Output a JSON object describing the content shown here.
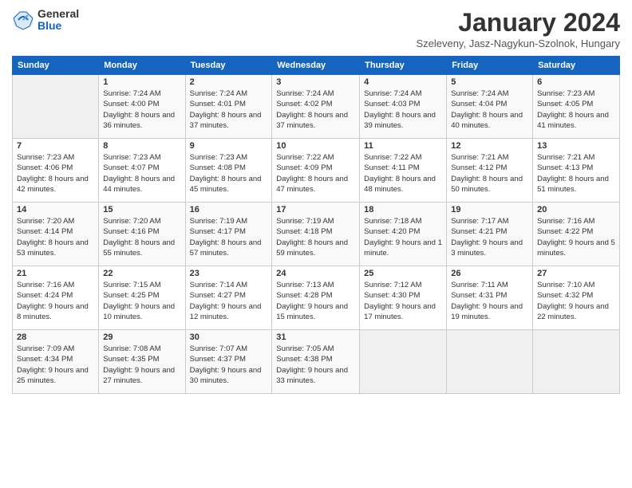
{
  "logo": {
    "general": "General",
    "blue": "Blue"
  },
  "title": "January 2024",
  "subtitle": "Szeleveny, Jasz-Nagykun-Szolnok, Hungary",
  "header_days": [
    "Sunday",
    "Monday",
    "Tuesday",
    "Wednesday",
    "Thursday",
    "Friday",
    "Saturday"
  ],
  "weeks": [
    [
      {
        "day": "",
        "sunrise": "",
        "sunset": "",
        "daylight": ""
      },
      {
        "day": "1",
        "sunrise": "Sunrise: 7:24 AM",
        "sunset": "Sunset: 4:00 PM",
        "daylight": "Daylight: 8 hours and 36 minutes."
      },
      {
        "day": "2",
        "sunrise": "Sunrise: 7:24 AM",
        "sunset": "Sunset: 4:01 PM",
        "daylight": "Daylight: 8 hours and 37 minutes."
      },
      {
        "day": "3",
        "sunrise": "Sunrise: 7:24 AM",
        "sunset": "Sunset: 4:02 PM",
        "daylight": "Daylight: 8 hours and 37 minutes."
      },
      {
        "day": "4",
        "sunrise": "Sunrise: 7:24 AM",
        "sunset": "Sunset: 4:03 PM",
        "daylight": "Daylight: 8 hours and 39 minutes."
      },
      {
        "day": "5",
        "sunrise": "Sunrise: 7:24 AM",
        "sunset": "Sunset: 4:04 PM",
        "daylight": "Daylight: 8 hours and 40 minutes."
      },
      {
        "day": "6",
        "sunrise": "Sunrise: 7:23 AM",
        "sunset": "Sunset: 4:05 PM",
        "daylight": "Daylight: 8 hours and 41 minutes."
      }
    ],
    [
      {
        "day": "7",
        "sunrise": "Sunrise: 7:23 AM",
        "sunset": "Sunset: 4:06 PM",
        "daylight": "Daylight: 8 hours and 42 minutes."
      },
      {
        "day": "8",
        "sunrise": "Sunrise: 7:23 AM",
        "sunset": "Sunset: 4:07 PM",
        "daylight": "Daylight: 8 hours and 44 minutes."
      },
      {
        "day": "9",
        "sunrise": "Sunrise: 7:23 AM",
        "sunset": "Sunset: 4:08 PM",
        "daylight": "Daylight: 8 hours and 45 minutes."
      },
      {
        "day": "10",
        "sunrise": "Sunrise: 7:22 AM",
        "sunset": "Sunset: 4:09 PM",
        "daylight": "Daylight: 8 hours and 47 minutes."
      },
      {
        "day": "11",
        "sunrise": "Sunrise: 7:22 AM",
        "sunset": "Sunset: 4:11 PM",
        "daylight": "Daylight: 8 hours and 48 minutes."
      },
      {
        "day": "12",
        "sunrise": "Sunrise: 7:21 AM",
        "sunset": "Sunset: 4:12 PM",
        "daylight": "Daylight: 8 hours and 50 minutes."
      },
      {
        "day": "13",
        "sunrise": "Sunrise: 7:21 AM",
        "sunset": "Sunset: 4:13 PM",
        "daylight": "Daylight: 8 hours and 51 minutes."
      }
    ],
    [
      {
        "day": "14",
        "sunrise": "Sunrise: 7:20 AM",
        "sunset": "Sunset: 4:14 PM",
        "daylight": "Daylight: 8 hours and 53 minutes."
      },
      {
        "day": "15",
        "sunrise": "Sunrise: 7:20 AM",
        "sunset": "Sunset: 4:16 PM",
        "daylight": "Daylight: 8 hours and 55 minutes."
      },
      {
        "day": "16",
        "sunrise": "Sunrise: 7:19 AM",
        "sunset": "Sunset: 4:17 PM",
        "daylight": "Daylight: 8 hours and 57 minutes."
      },
      {
        "day": "17",
        "sunrise": "Sunrise: 7:19 AM",
        "sunset": "Sunset: 4:18 PM",
        "daylight": "Daylight: 8 hours and 59 minutes."
      },
      {
        "day": "18",
        "sunrise": "Sunrise: 7:18 AM",
        "sunset": "Sunset: 4:20 PM",
        "daylight": "Daylight: 9 hours and 1 minute."
      },
      {
        "day": "19",
        "sunrise": "Sunrise: 7:17 AM",
        "sunset": "Sunset: 4:21 PM",
        "daylight": "Daylight: 9 hours and 3 minutes."
      },
      {
        "day": "20",
        "sunrise": "Sunrise: 7:16 AM",
        "sunset": "Sunset: 4:22 PM",
        "daylight": "Daylight: 9 hours and 5 minutes."
      }
    ],
    [
      {
        "day": "21",
        "sunrise": "Sunrise: 7:16 AM",
        "sunset": "Sunset: 4:24 PM",
        "daylight": "Daylight: 9 hours and 8 minutes."
      },
      {
        "day": "22",
        "sunrise": "Sunrise: 7:15 AM",
        "sunset": "Sunset: 4:25 PM",
        "daylight": "Daylight: 9 hours and 10 minutes."
      },
      {
        "day": "23",
        "sunrise": "Sunrise: 7:14 AM",
        "sunset": "Sunset: 4:27 PM",
        "daylight": "Daylight: 9 hours and 12 minutes."
      },
      {
        "day": "24",
        "sunrise": "Sunrise: 7:13 AM",
        "sunset": "Sunset: 4:28 PM",
        "daylight": "Daylight: 9 hours and 15 minutes."
      },
      {
        "day": "25",
        "sunrise": "Sunrise: 7:12 AM",
        "sunset": "Sunset: 4:30 PM",
        "daylight": "Daylight: 9 hours and 17 minutes."
      },
      {
        "day": "26",
        "sunrise": "Sunrise: 7:11 AM",
        "sunset": "Sunset: 4:31 PM",
        "daylight": "Daylight: 9 hours and 19 minutes."
      },
      {
        "day": "27",
        "sunrise": "Sunrise: 7:10 AM",
        "sunset": "Sunset: 4:32 PM",
        "daylight": "Daylight: 9 hours and 22 minutes."
      }
    ],
    [
      {
        "day": "28",
        "sunrise": "Sunrise: 7:09 AM",
        "sunset": "Sunset: 4:34 PM",
        "daylight": "Daylight: 9 hours and 25 minutes."
      },
      {
        "day": "29",
        "sunrise": "Sunrise: 7:08 AM",
        "sunset": "Sunset: 4:35 PM",
        "daylight": "Daylight: 9 hours and 27 minutes."
      },
      {
        "day": "30",
        "sunrise": "Sunrise: 7:07 AM",
        "sunset": "Sunset: 4:37 PM",
        "daylight": "Daylight: 9 hours and 30 minutes."
      },
      {
        "day": "31",
        "sunrise": "Sunrise: 7:05 AM",
        "sunset": "Sunset: 4:38 PM",
        "daylight": "Daylight: 9 hours and 33 minutes."
      },
      {
        "day": "",
        "sunrise": "",
        "sunset": "",
        "daylight": ""
      },
      {
        "day": "",
        "sunrise": "",
        "sunset": "",
        "daylight": ""
      },
      {
        "day": "",
        "sunrise": "",
        "sunset": "",
        "daylight": ""
      }
    ]
  ]
}
